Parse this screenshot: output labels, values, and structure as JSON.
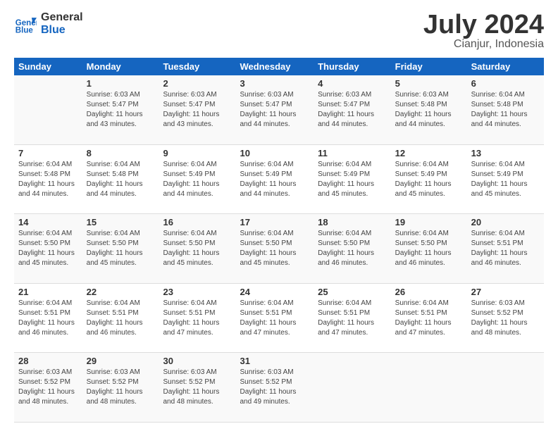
{
  "logo": {
    "text_general": "General",
    "text_blue": "Blue"
  },
  "title": "July 2024",
  "subtitle": "Cianjur, Indonesia",
  "days_header": [
    "Sunday",
    "Monday",
    "Tuesday",
    "Wednesday",
    "Thursday",
    "Friday",
    "Saturday"
  ],
  "weeks": [
    [
      {
        "num": "",
        "detail": ""
      },
      {
        "num": "1",
        "detail": "Sunrise: 6:03 AM\nSunset: 5:47 PM\nDaylight: 11 hours\nand 43 minutes."
      },
      {
        "num": "2",
        "detail": "Sunrise: 6:03 AM\nSunset: 5:47 PM\nDaylight: 11 hours\nand 43 minutes."
      },
      {
        "num": "3",
        "detail": "Sunrise: 6:03 AM\nSunset: 5:47 PM\nDaylight: 11 hours\nand 44 minutes."
      },
      {
        "num": "4",
        "detail": "Sunrise: 6:03 AM\nSunset: 5:47 PM\nDaylight: 11 hours\nand 44 minutes."
      },
      {
        "num": "5",
        "detail": "Sunrise: 6:03 AM\nSunset: 5:48 PM\nDaylight: 11 hours\nand 44 minutes."
      },
      {
        "num": "6",
        "detail": "Sunrise: 6:04 AM\nSunset: 5:48 PM\nDaylight: 11 hours\nand 44 minutes."
      }
    ],
    [
      {
        "num": "7",
        "detail": "Sunrise: 6:04 AM\nSunset: 5:48 PM\nDaylight: 11 hours\nand 44 minutes."
      },
      {
        "num": "8",
        "detail": "Sunrise: 6:04 AM\nSunset: 5:48 PM\nDaylight: 11 hours\nand 44 minutes."
      },
      {
        "num": "9",
        "detail": "Sunrise: 6:04 AM\nSunset: 5:49 PM\nDaylight: 11 hours\nand 44 minutes."
      },
      {
        "num": "10",
        "detail": "Sunrise: 6:04 AM\nSunset: 5:49 PM\nDaylight: 11 hours\nand 44 minutes."
      },
      {
        "num": "11",
        "detail": "Sunrise: 6:04 AM\nSunset: 5:49 PM\nDaylight: 11 hours\nand 45 minutes."
      },
      {
        "num": "12",
        "detail": "Sunrise: 6:04 AM\nSunset: 5:49 PM\nDaylight: 11 hours\nand 45 minutes."
      },
      {
        "num": "13",
        "detail": "Sunrise: 6:04 AM\nSunset: 5:49 PM\nDaylight: 11 hours\nand 45 minutes."
      }
    ],
    [
      {
        "num": "14",
        "detail": "Sunrise: 6:04 AM\nSunset: 5:50 PM\nDaylight: 11 hours\nand 45 minutes."
      },
      {
        "num": "15",
        "detail": "Sunrise: 6:04 AM\nSunset: 5:50 PM\nDaylight: 11 hours\nand 45 minutes."
      },
      {
        "num": "16",
        "detail": "Sunrise: 6:04 AM\nSunset: 5:50 PM\nDaylight: 11 hours\nand 45 minutes."
      },
      {
        "num": "17",
        "detail": "Sunrise: 6:04 AM\nSunset: 5:50 PM\nDaylight: 11 hours\nand 45 minutes."
      },
      {
        "num": "18",
        "detail": "Sunrise: 6:04 AM\nSunset: 5:50 PM\nDaylight: 11 hours\nand 46 minutes."
      },
      {
        "num": "19",
        "detail": "Sunrise: 6:04 AM\nSunset: 5:50 PM\nDaylight: 11 hours\nand 46 minutes."
      },
      {
        "num": "20",
        "detail": "Sunrise: 6:04 AM\nSunset: 5:51 PM\nDaylight: 11 hours\nand 46 minutes."
      }
    ],
    [
      {
        "num": "21",
        "detail": "Sunrise: 6:04 AM\nSunset: 5:51 PM\nDaylight: 11 hours\nand 46 minutes."
      },
      {
        "num": "22",
        "detail": "Sunrise: 6:04 AM\nSunset: 5:51 PM\nDaylight: 11 hours\nand 46 minutes."
      },
      {
        "num": "23",
        "detail": "Sunrise: 6:04 AM\nSunset: 5:51 PM\nDaylight: 11 hours\nand 47 minutes."
      },
      {
        "num": "24",
        "detail": "Sunrise: 6:04 AM\nSunset: 5:51 PM\nDaylight: 11 hours\nand 47 minutes."
      },
      {
        "num": "25",
        "detail": "Sunrise: 6:04 AM\nSunset: 5:51 PM\nDaylight: 11 hours\nand 47 minutes."
      },
      {
        "num": "26",
        "detail": "Sunrise: 6:04 AM\nSunset: 5:51 PM\nDaylight: 11 hours\nand 47 minutes."
      },
      {
        "num": "27",
        "detail": "Sunrise: 6:03 AM\nSunset: 5:52 PM\nDaylight: 11 hours\nand 48 minutes."
      }
    ],
    [
      {
        "num": "28",
        "detail": "Sunrise: 6:03 AM\nSunset: 5:52 PM\nDaylight: 11 hours\nand 48 minutes."
      },
      {
        "num": "29",
        "detail": "Sunrise: 6:03 AM\nSunset: 5:52 PM\nDaylight: 11 hours\nand 48 minutes."
      },
      {
        "num": "30",
        "detail": "Sunrise: 6:03 AM\nSunset: 5:52 PM\nDaylight: 11 hours\nand 48 minutes."
      },
      {
        "num": "31",
        "detail": "Sunrise: 6:03 AM\nSunset: 5:52 PM\nDaylight: 11 hours\nand 49 minutes."
      },
      {
        "num": "",
        "detail": ""
      },
      {
        "num": "",
        "detail": ""
      },
      {
        "num": "",
        "detail": ""
      }
    ]
  ]
}
